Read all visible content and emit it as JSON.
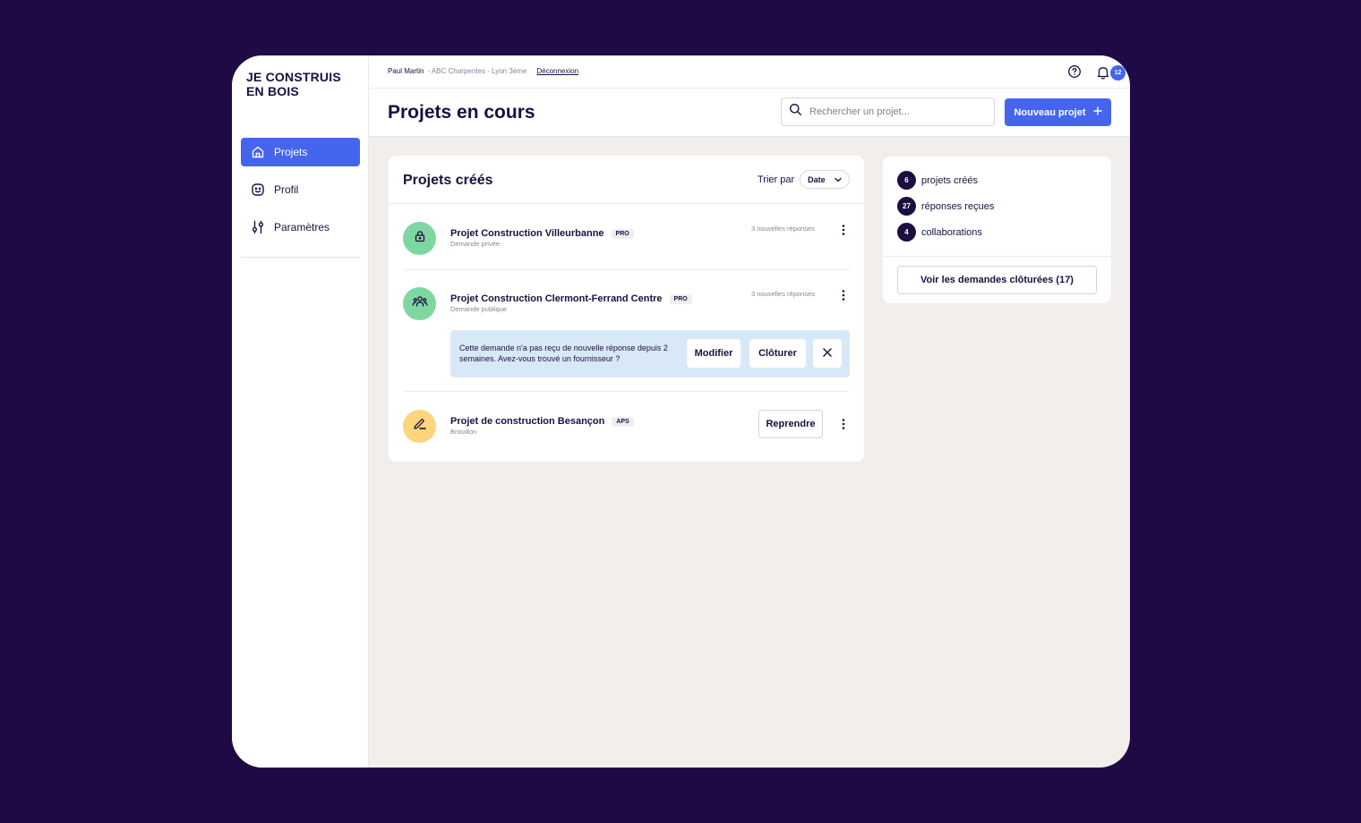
{
  "brand": {
    "logo_text": "JE CONSTRUIS EN BOIS"
  },
  "sidebar": {
    "items": [
      {
        "label": "Projets",
        "icon": "home-icon",
        "active": true
      },
      {
        "label": "Profil",
        "icon": "smiley-icon",
        "active": false
      },
      {
        "label": "Paramètres",
        "icon": "sliders-icon",
        "active": false
      }
    ]
  },
  "header": {
    "user_name": "Paul Martin",
    "user_context": "- ABC Charpentes - Lyon 3ème",
    "logout_label": "Déconnexion",
    "notification_count": "12",
    "page_title": "Projets en cours",
    "search_placeholder": "Rechercher un projet...",
    "new_project_label": "Nouveau projet"
  },
  "projects_card": {
    "title": "Projets créés",
    "sort_label": "Trier par",
    "sort_value": "Date",
    "projects": [
      {
        "name": "Projet Construction Villeurbanne",
        "tag": "PRO",
        "subtitle": "Demande privée",
        "meta": "3 nouvelles réponses",
        "icon": "lock-icon"
      },
      {
        "name": "Projet Construction Clermont-Ferrand Centre",
        "tag": "PRO",
        "subtitle": "Demande publique",
        "meta": "3 nouvelles réponses",
        "icon": "group-icon"
      },
      {
        "name": "Projet de construction Besançon",
        "tag": "APS",
        "subtitle": "Brouillon",
        "action_label": "Reprendre",
        "icon": "pencil-icon"
      }
    ],
    "alert": {
      "text": "Cette demande n'a pas reçu de nouvelle réponse depuis 2 semaines. Avez-vous trouvé un fournisseur ?",
      "modify_label": "Modifier",
      "close_label": "Clôturer"
    }
  },
  "stats": {
    "items": [
      {
        "count": "6",
        "label": "projets créés"
      },
      {
        "count": "27",
        "label": "réponses reçues"
      },
      {
        "count": "4",
        "label": "collaborations"
      }
    ],
    "closed_button_label": "Voir les demandes clôturées (17)"
  },
  "colors": {
    "background": "#1f0a45",
    "accent": "#4565ef",
    "text": "#1c0f3f",
    "content_bg": "#f2eeec",
    "avatar_green": "#7ed7a1",
    "avatar_yellow": "#fcd57c",
    "alert_bg": "#d9e8f6"
  }
}
